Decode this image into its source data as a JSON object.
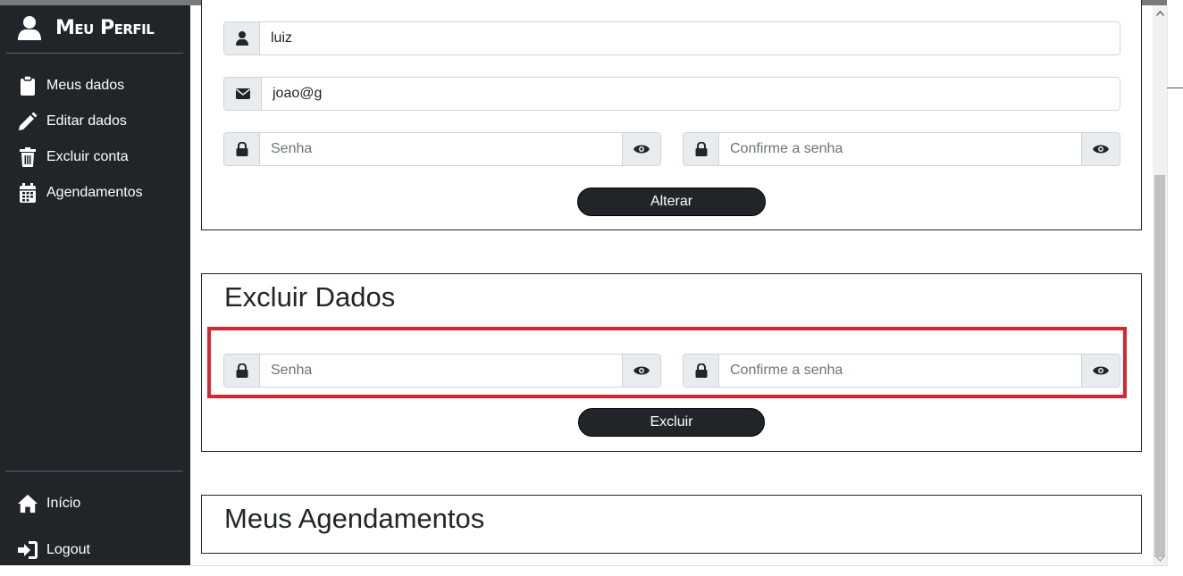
{
  "sidebar": {
    "title": "Meu Perfil",
    "menu": [
      {
        "label": "Meus dados",
        "icon": "clipboard-icon"
      },
      {
        "label": "Editar dados",
        "icon": "pencil-icon"
      },
      {
        "label": "Excluir conta",
        "icon": "trash-icon"
      },
      {
        "label": "Agendamentos",
        "icon": "calendar-icon"
      }
    ],
    "footer": [
      {
        "label": "Início",
        "icon": "home-icon"
      },
      {
        "label": "Logout",
        "icon": "logout-icon"
      }
    ]
  },
  "edit_section": {
    "name_value": "luiz",
    "email_value": "joao@g",
    "password_placeholder": "Senha",
    "confirm_placeholder": "Confirme a senha",
    "submit_label": "Alterar"
  },
  "delete_section": {
    "title": "Excluir Dados",
    "password_placeholder": "Senha",
    "confirm_placeholder": "Confirme a senha",
    "submit_label": "Excluir"
  },
  "appointments_section": {
    "title": "Meus Agendamentos"
  },
  "colors": {
    "sidebar_bg": "#212529",
    "highlight_border": "#d72632",
    "button_bg": "#212529"
  }
}
